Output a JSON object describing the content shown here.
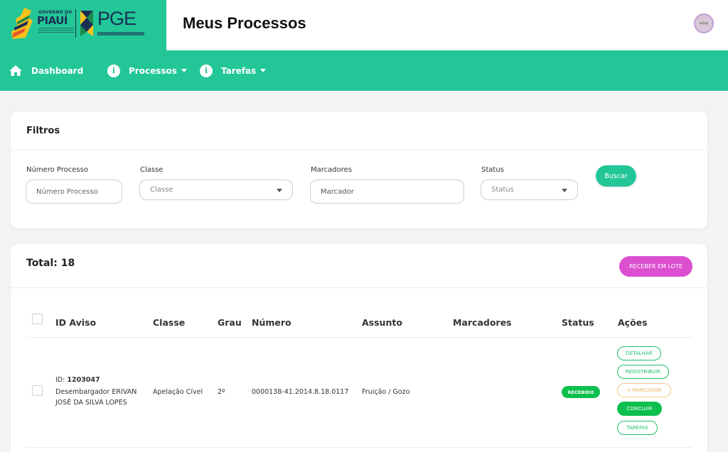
{
  "header": {
    "logo_gov_text": "GOVERNO DO",
    "logo_state_text": "PIAUÍ",
    "logo_org_text": "PGE",
    "title": "Meus Processos"
  },
  "nav": {
    "items": [
      {
        "label": "Dashboard",
        "icon": "home-icon",
        "has_dropdown": false
      },
      {
        "label": "Processos",
        "icon": "info-icon",
        "has_dropdown": true
      },
      {
        "label": "Tarefas",
        "icon": "info-icon",
        "has_dropdown": true
      }
    ]
  },
  "filters": {
    "title": "Filtros",
    "numero_label": "Número Processo",
    "numero_placeholder": "Número Processo",
    "classe_label": "Classe",
    "classe_placeholder": "Classe",
    "marcadores_label": "Marcadores",
    "marcadores_placeholder": "Marcador",
    "status_label": "Status",
    "status_placeholder": "Status",
    "buscar_label": "Buscar"
  },
  "results": {
    "total_text": "Total: 18",
    "receber_lote_label": "RECEBER EM LOTE",
    "columns": [
      "ID Aviso",
      "Classe",
      "Grau",
      "Número",
      "Assunto",
      "Marcadores",
      "Status",
      "Ações"
    ],
    "rows": [
      {
        "id_prefix": "ID:",
        "id": "1203047",
        "responsavel_line1": "Desembargador ERIVAN",
        "responsavel_line2": "JOSÉ DA SILVA LOPES",
        "classe": "Apelação Cível",
        "grau": "2º",
        "numero": "0000138-41.2014.8.18.0117",
        "assunto": "Fruição / Gozo",
        "marcadores": "",
        "status": "RECEBIDO",
        "actions": {
          "detalhar": "DETALHAR",
          "redistribuir": "REDISTRIBUIR",
          "marcador": "+ MARCADOR",
          "concluir": "CONCLUIR",
          "tarefas": "TAREFAS"
        }
      }
    ]
  },
  "colors": {
    "brand_green": "#23c797",
    "badge_green": "#0dbf4f",
    "lote_pink": "#dc4fce",
    "marcador_orange": "#f0b25f"
  }
}
